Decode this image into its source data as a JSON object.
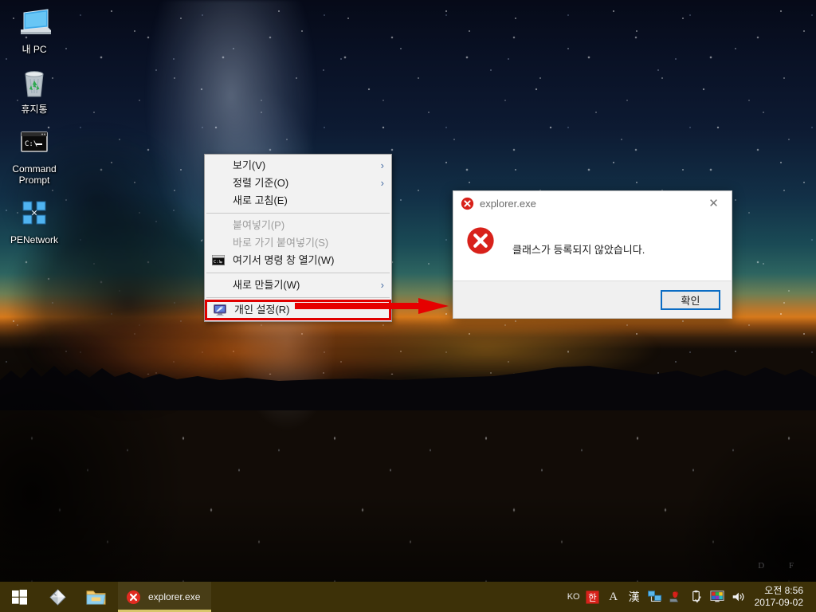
{
  "desktop": {
    "icons": [
      {
        "label": "내 PC",
        "icon": "this-pc-icon"
      },
      {
        "label": "휴지통",
        "icon": "recycle-bin-icon"
      },
      {
        "label": "Command Prompt",
        "icon": "command-prompt-icon"
      },
      {
        "label": "PENetwork",
        "icon": "penetwork-icon"
      }
    ],
    "watermark": "D F"
  },
  "context_menu": {
    "items": [
      {
        "label": "보기(V)",
        "submenu": "›",
        "disabled": false,
        "icon": null
      },
      {
        "label": "정렬 기준(O)",
        "submenu": "›",
        "disabled": false,
        "icon": null
      },
      {
        "label": "새로 고침(E)",
        "submenu": "",
        "disabled": false,
        "icon": null
      },
      {
        "separator": true
      },
      {
        "label": "붙여넣기(P)",
        "submenu": "",
        "disabled": true,
        "icon": null
      },
      {
        "label": "바로 가기 붙여넣기(S)",
        "submenu": "",
        "disabled": true,
        "icon": null
      },
      {
        "label": "여기서 명령 창 열기(W)",
        "submenu": "",
        "disabled": false,
        "icon": "command-prompt-icon"
      },
      {
        "separator": true
      },
      {
        "label": "새로 만들기(W)",
        "submenu": "›",
        "disabled": false,
        "icon": null
      },
      {
        "separator": true
      },
      {
        "label": "개인 설정(R)",
        "submenu": "",
        "disabled": false,
        "icon": "personalization-icon",
        "highlighted": true
      }
    ]
  },
  "annotation": {
    "color": "#e60000",
    "type": "arrow-right"
  },
  "dialog": {
    "title": "explorer.exe",
    "title_icon": "error-circle-icon",
    "close_label": "✕",
    "body_icon": "error-circle-icon",
    "message": "클래스가 등록되지 않았습니다.",
    "ok_label": "확인",
    "accent": "#0a6cc4"
  },
  "taskbar": {
    "start_icon": "windows-start-icon",
    "pinned": [
      {
        "name": "gem-icon"
      },
      {
        "name": "file-explorer-icon"
      }
    ],
    "tasks": [
      {
        "label": "explorer.exe",
        "icon": "error-circle-icon",
        "active": true
      }
    ],
    "tray": {
      "language": "KO",
      "ime_mode": "한",
      "ime_alpha": "A",
      "ime_hanja": "漢",
      "icons": [
        {
          "name": "network-icon"
        },
        {
          "name": "hardware-device-icon"
        },
        {
          "name": "usb-safely-remove-icon"
        },
        {
          "name": "display-color-icon"
        },
        {
          "name": "volume-icon"
        }
      ]
    },
    "clock": {
      "time": "오전 8:56",
      "date": "2017-09-02"
    },
    "background": "#3d3108"
  }
}
